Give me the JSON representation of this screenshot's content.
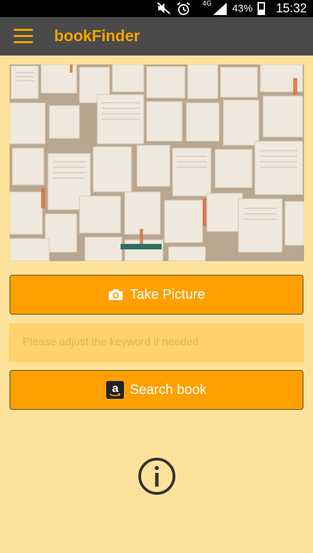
{
  "status_bar": {
    "network": "4G",
    "battery": "43%",
    "time": "15:32"
  },
  "app_bar": {
    "title": "bookFinder"
  },
  "actions": {
    "take_picture_label": "Take Picture",
    "keyword_placeholder": "Please adjust the keyword if needed",
    "keyword_value": "",
    "search_label": "Search book"
  },
  "icons": {
    "menu": "hamburger-menu-icon",
    "camera": "camera-icon",
    "amazon": "amazon-logo-icon",
    "info": "info-icon"
  },
  "colors": {
    "background": "#ffe29a",
    "app_bar": "#4a4a4a",
    "accent": "#f5a400",
    "button": "#ffa000",
    "input_bg": "#ffd26b"
  }
}
